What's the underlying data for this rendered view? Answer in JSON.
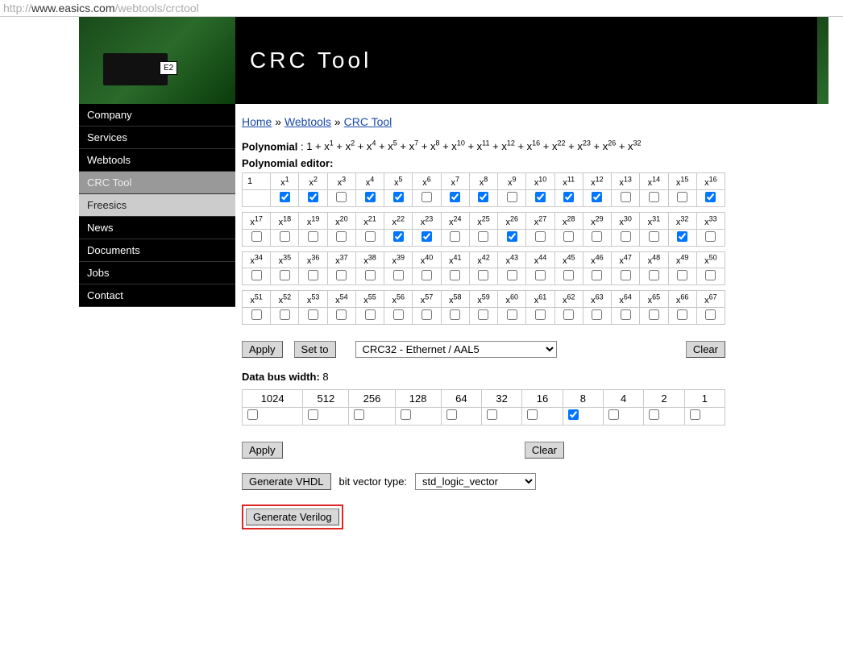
{
  "url": {
    "host": "www.easics.com",
    "path": "/webtools/crctool",
    "prefix": "http://"
  },
  "header": {
    "title": "CRC Tool"
  },
  "sidebar": {
    "items": [
      {
        "label": "Company",
        "cls": "black"
      },
      {
        "label": "Services",
        "cls": "black"
      },
      {
        "label": "Webtools",
        "cls": "black"
      },
      {
        "label": "CRC Tool",
        "cls": "ltgray"
      },
      {
        "label": "Freesics",
        "cls": "gray"
      },
      {
        "label": "News",
        "cls": "black"
      },
      {
        "label": "Documents",
        "cls": "black"
      },
      {
        "label": "Jobs",
        "cls": "black"
      },
      {
        "label": "Contact",
        "cls": "black"
      }
    ]
  },
  "breadcrumb": {
    "home": "Home",
    "sep": " » ",
    "webtools": "Webtools",
    "crctool": "CRC Tool"
  },
  "polynomial": {
    "label": "Polynomial",
    "exponents": [
      1,
      2,
      4,
      5,
      7,
      8,
      10,
      11,
      12,
      16,
      22,
      23,
      26,
      32
    ]
  },
  "editor": {
    "label": "Polynomial editor:",
    "checked": [
      1,
      2,
      4,
      5,
      7,
      8,
      10,
      11,
      12,
      16,
      22,
      23,
      26,
      32
    ],
    "maxExp": 67
  },
  "buttons": {
    "apply": "Apply",
    "setto": "Set to",
    "clear": "Clear",
    "gen_vhdl": "Generate VHDL",
    "gen_verilog": "Generate Verilog"
  },
  "preset": {
    "selected": "CRC32 - Ethernet / AAL5"
  },
  "dbw": {
    "label": "Data bus width",
    "value": "8",
    "widths": [
      1024,
      512,
      256,
      128,
      64,
      32,
      16,
      8,
      4,
      2,
      1
    ],
    "checked": 8
  },
  "vhdl": {
    "bvt_label": "bit vector type:",
    "bvt_value": "std_logic_vector"
  }
}
